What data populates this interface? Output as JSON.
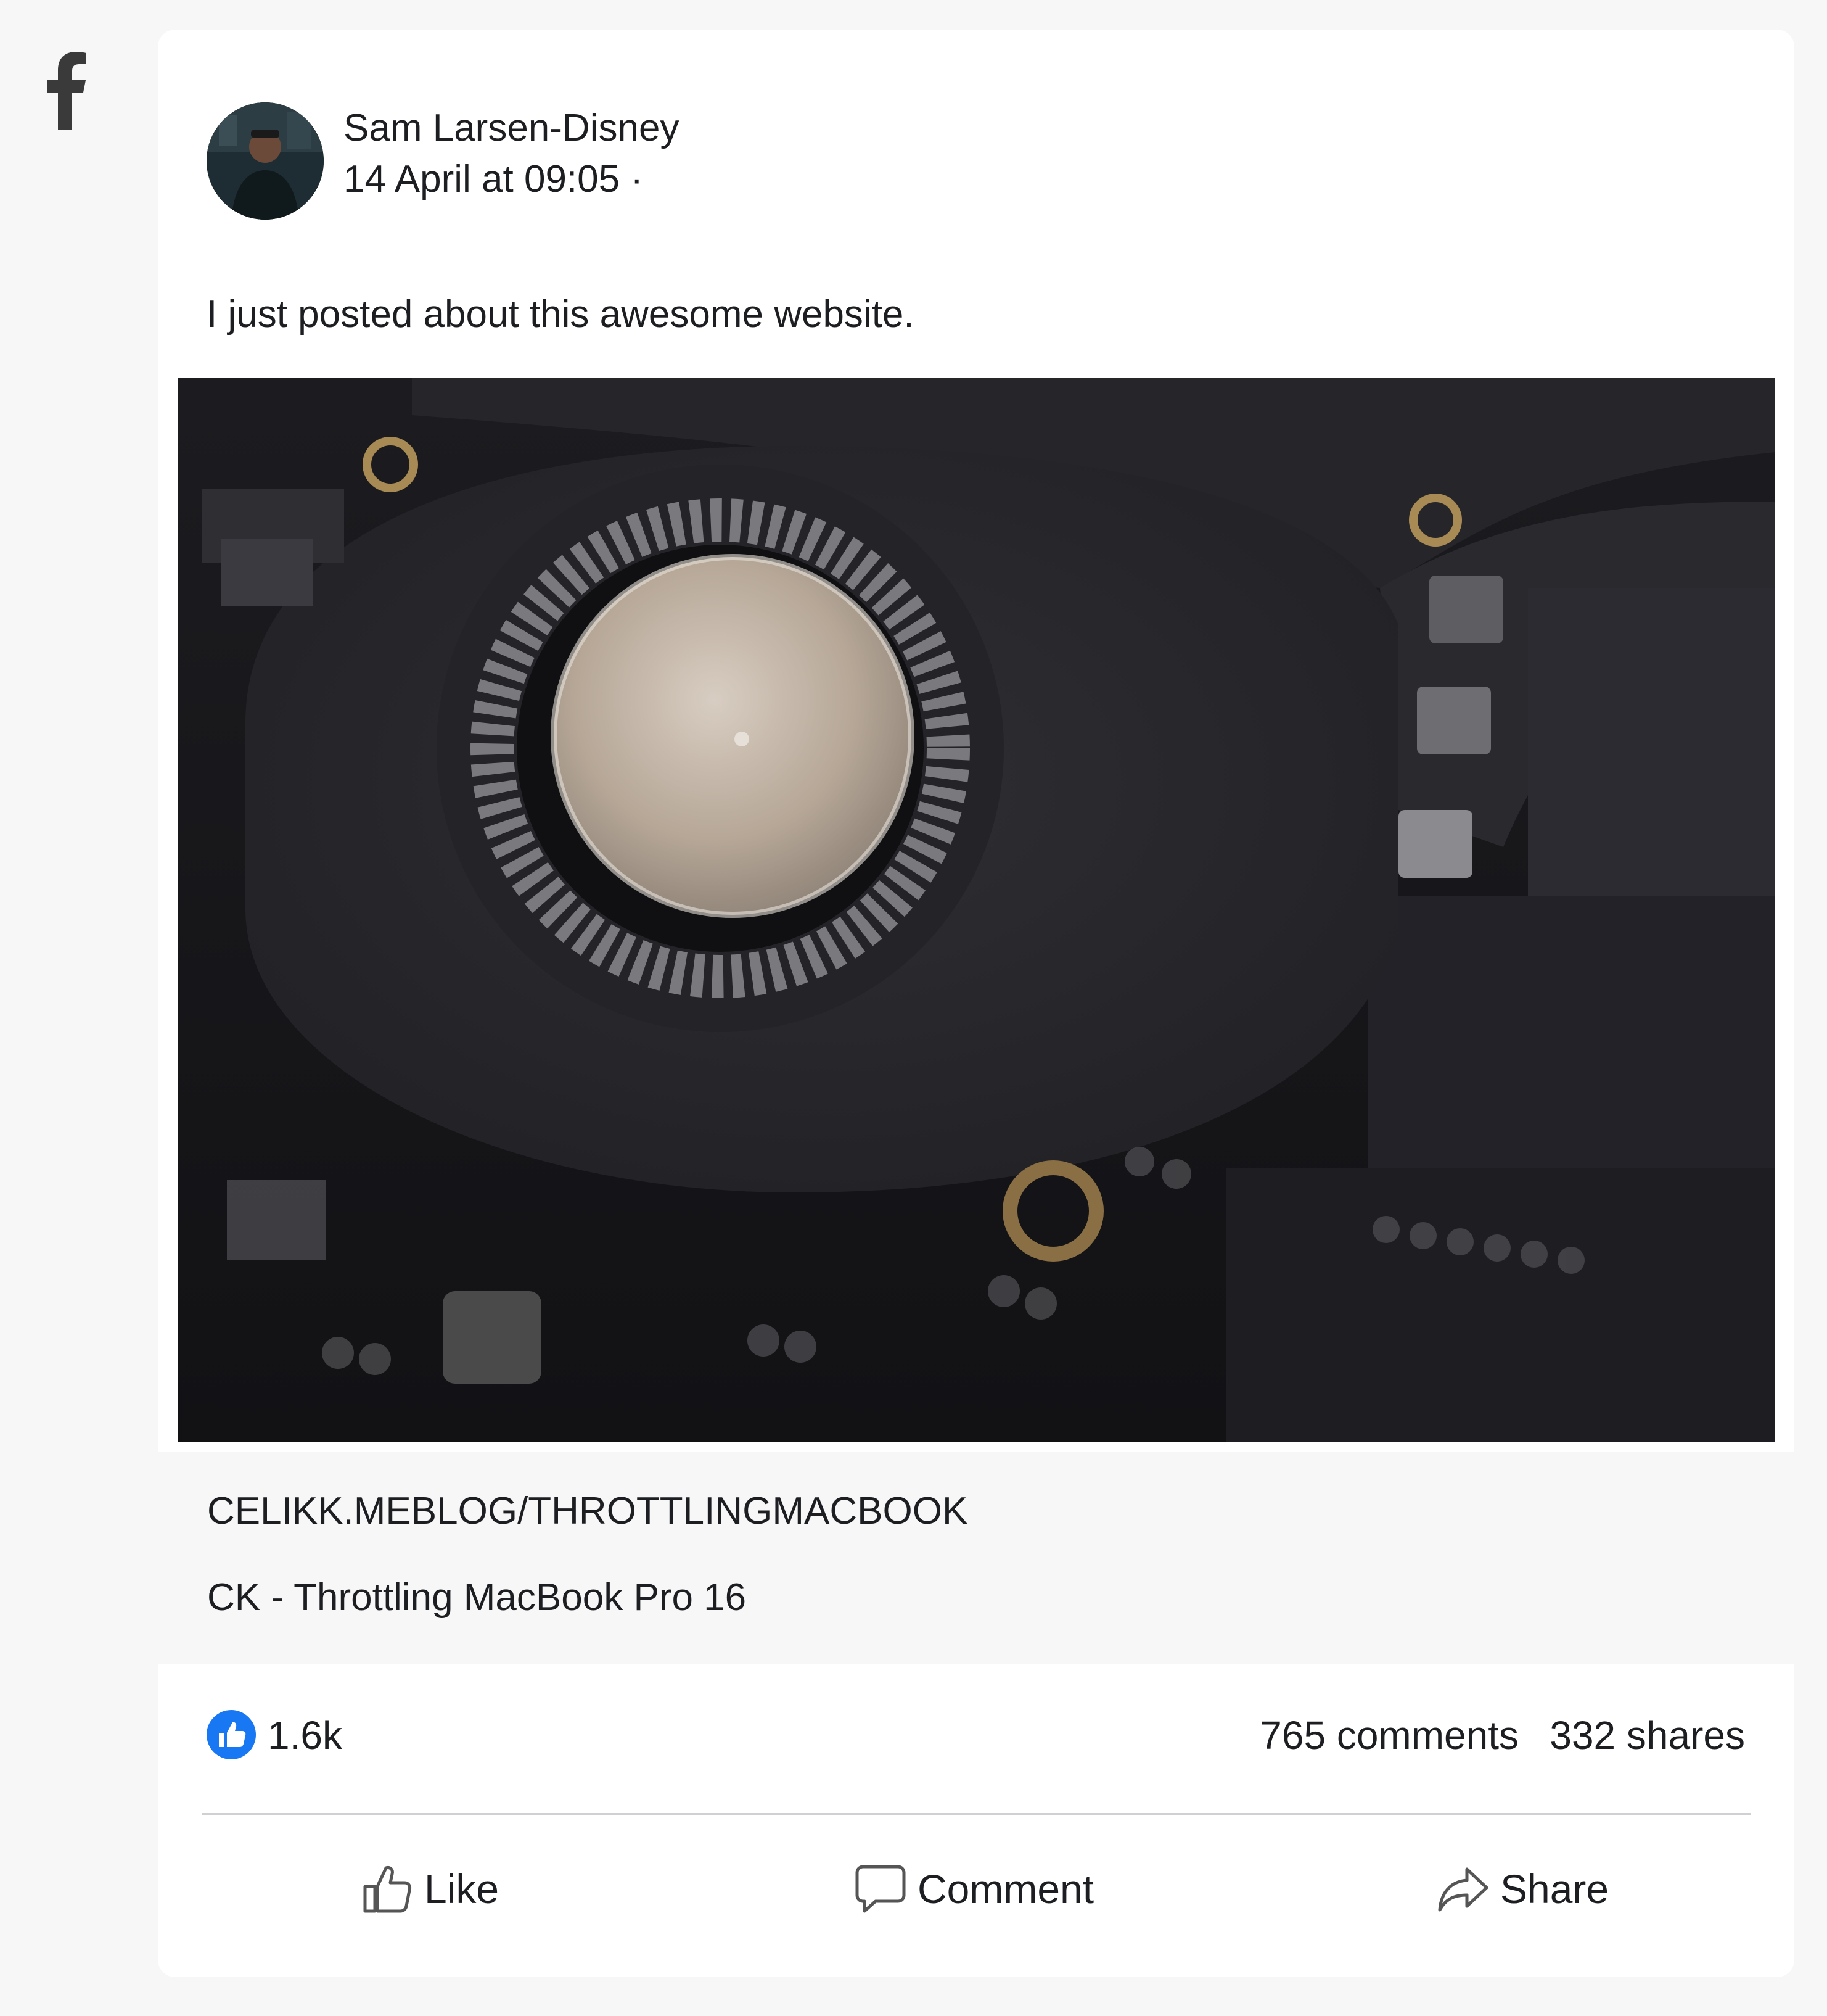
{
  "app": {
    "logo_icon": "facebook-f-icon"
  },
  "post": {
    "author": "Sam Larsen-Disney",
    "timestamp": "14 April at 09:05 ·",
    "text": "I just posted about this awesome website.",
    "image_icon": "laptop-fan-photo"
  },
  "link": {
    "url": "CELIKK.MEBLOG/THROTTLINGMACBOOK",
    "title": "CK - Throttling MacBook Pro 16"
  },
  "stats": {
    "likes": "1.6k",
    "comments": "765 comments",
    "shares": "332 shares"
  },
  "actions": {
    "like": "Like",
    "comment": "Comment",
    "share": "Share"
  },
  "colors": {
    "like_blue": "#1877f2",
    "text": "#1c1e21",
    "background": "#f7f7f7"
  }
}
